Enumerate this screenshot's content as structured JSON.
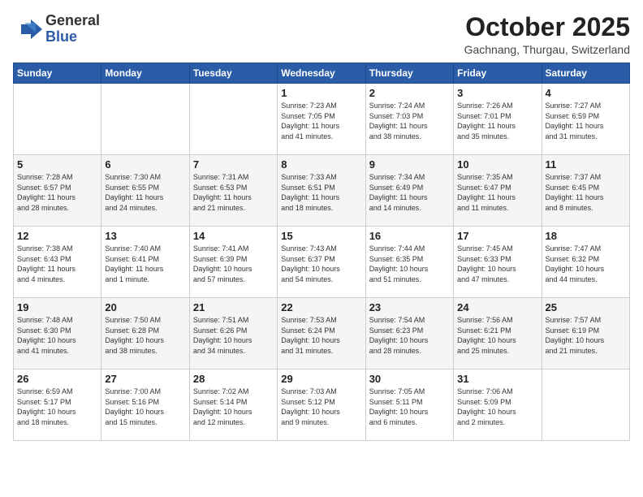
{
  "header": {
    "logo_general": "General",
    "logo_blue": "Blue",
    "month_title": "October 2025",
    "location": "Gachnang, Thurgau, Switzerland"
  },
  "weekdays": [
    "Sunday",
    "Monday",
    "Tuesday",
    "Wednesday",
    "Thursday",
    "Friday",
    "Saturday"
  ],
  "weeks": [
    [
      {
        "day": "",
        "content": ""
      },
      {
        "day": "",
        "content": ""
      },
      {
        "day": "",
        "content": ""
      },
      {
        "day": "1",
        "content": "Sunrise: 7:23 AM\nSunset: 7:05 PM\nDaylight: 11 hours\nand 41 minutes."
      },
      {
        "day": "2",
        "content": "Sunrise: 7:24 AM\nSunset: 7:03 PM\nDaylight: 11 hours\nand 38 minutes."
      },
      {
        "day": "3",
        "content": "Sunrise: 7:26 AM\nSunset: 7:01 PM\nDaylight: 11 hours\nand 35 minutes."
      },
      {
        "day": "4",
        "content": "Sunrise: 7:27 AM\nSunset: 6:59 PM\nDaylight: 11 hours\nand 31 minutes."
      }
    ],
    [
      {
        "day": "5",
        "content": "Sunrise: 7:28 AM\nSunset: 6:57 PM\nDaylight: 11 hours\nand 28 minutes."
      },
      {
        "day": "6",
        "content": "Sunrise: 7:30 AM\nSunset: 6:55 PM\nDaylight: 11 hours\nand 24 minutes."
      },
      {
        "day": "7",
        "content": "Sunrise: 7:31 AM\nSunset: 6:53 PM\nDaylight: 11 hours\nand 21 minutes."
      },
      {
        "day": "8",
        "content": "Sunrise: 7:33 AM\nSunset: 6:51 PM\nDaylight: 11 hours\nand 18 minutes."
      },
      {
        "day": "9",
        "content": "Sunrise: 7:34 AM\nSunset: 6:49 PM\nDaylight: 11 hours\nand 14 minutes."
      },
      {
        "day": "10",
        "content": "Sunrise: 7:35 AM\nSunset: 6:47 PM\nDaylight: 11 hours\nand 11 minutes."
      },
      {
        "day": "11",
        "content": "Sunrise: 7:37 AM\nSunset: 6:45 PM\nDaylight: 11 hours\nand 8 minutes."
      }
    ],
    [
      {
        "day": "12",
        "content": "Sunrise: 7:38 AM\nSunset: 6:43 PM\nDaylight: 11 hours\nand 4 minutes."
      },
      {
        "day": "13",
        "content": "Sunrise: 7:40 AM\nSunset: 6:41 PM\nDaylight: 11 hours\nand 1 minute."
      },
      {
        "day": "14",
        "content": "Sunrise: 7:41 AM\nSunset: 6:39 PM\nDaylight: 10 hours\nand 57 minutes."
      },
      {
        "day": "15",
        "content": "Sunrise: 7:43 AM\nSunset: 6:37 PM\nDaylight: 10 hours\nand 54 minutes."
      },
      {
        "day": "16",
        "content": "Sunrise: 7:44 AM\nSunset: 6:35 PM\nDaylight: 10 hours\nand 51 minutes."
      },
      {
        "day": "17",
        "content": "Sunrise: 7:45 AM\nSunset: 6:33 PM\nDaylight: 10 hours\nand 47 minutes."
      },
      {
        "day": "18",
        "content": "Sunrise: 7:47 AM\nSunset: 6:32 PM\nDaylight: 10 hours\nand 44 minutes."
      }
    ],
    [
      {
        "day": "19",
        "content": "Sunrise: 7:48 AM\nSunset: 6:30 PM\nDaylight: 10 hours\nand 41 minutes."
      },
      {
        "day": "20",
        "content": "Sunrise: 7:50 AM\nSunset: 6:28 PM\nDaylight: 10 hours\nand 38 minutes."
      },
      {
        "day": "21",
        "content": "Sunrise: 7:51 AM\nSunset: 6:26 PM\nDaylight: 10 hours\nand 34 minutes."
      },
      {
        "day": "22",
        "content": "Sunrise: 7:53 AM\nSunset: 6:24 PM\nDaylight: 10 hours\nand 31 minutes."
      },
      {
        "day": "23",
        "content": "Sunrise: 7:54 AM\nSunset: 6:23 PM\nDaylight: 10 hours\nand 28 minutes."
      },
      {
        "day": "24",
        "content": "Sunrise: 7:56 AM\nSunset: 6:21 PM\nDaylight: 10 hours\nand 25 minutes."
      },
      {
        "day": "25",
        "content": "Sunrise: 7:57 AM\nSunset: 6:19 PM\nDaylight: 10 hours\nand 21 minutes."
      }
    ],
    [
      {
        "day": "26",
        "content": "Sunrise: 6:59 AM\nSunset: 5:17 PM\nDaylight: 10 hours\nand 18 minutes."
      },
      {
        "day": "27",
        "content": "Sunrise: 7:00 AM\nSunset: 5:16 PM\nDaylight: 10 hours\nand 15 minutes."
      },
      {
        "day": "28",
        "content": "Sunrise: 7:02 AM\nSunset: 5:14 PM\nDaylight: 10 hours\nand 12 minutes."
      },
      {
        "day": "29",
        "content": "Sunrise: 7:03 AM\nSunset: 5:12 PM\nDaylight: 10 hours\nand 9 minutes."
      },
      {
        "day": "30",
        "content": "Sunrise: 7:05 AM\nSunset: 5:11 PM\nDaylight: 10 hours\nand 6 minutes."
      },
      {
        "day": "31",
        "content": "Sunrise: 7:06 AM\nSunset: 5:09 PM\nDaylight: 10 hours\nand 2 minutes."
      },
      {
        "day": "",
        "content": ""
      }
    ]
  ]
}
